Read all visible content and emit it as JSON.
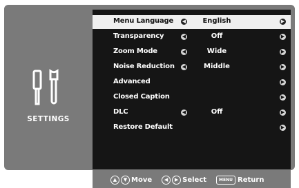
{
  "sidebar": {
    "title": "SETTINGS",
    "icon": "settings-tools-icon"
  },
  "menu": {
    "items": [
      {
        "label": "Menu Language",
        "value": "English",
        "has_left_arrow": true,
        "selected": true
      },
      {
        "label": "Transparency",
        "value": "Off",
        "has_left_arrow": true,
        "selected": false
      },
      {
        "label": "Zoom Mode",
        "value": "Wide",
        "has_left_arrow": true,
        "selected": false
      },
      {
        "label": "Noise Reduction",
        "value": "Middle",
        "has_left_arrow": true,
        "selected": false
      },
      {
        "label": "Advanced",
        "value": "",
        "has_left_arrow": false,
        "selected": false
      },
      {
        "label": "Closed Caption",
        "value": "",
        "has_left_arrow": false,
        "selected": false
      },
      {
        "label": "DLC",
        "value": "Off",
        "has_left_arrow": true,
        "selected": false
      },
      {
        "label": "Restore Default",
        "value": "",
        "has_left_arrow": false,
        "selected": false
      }
    ]
  },
  "footer": {
    "move_label": "Move",
    "select_label": "Select",
    "menu_button": "MENU",
    "return_label": "Return"
  },
  "colors": {
    "panel": "#7a7a7a",
    "menu_bg": "#151515",
    "highlight": "#efefef",
    "text": "#ffffff"
  }
}
